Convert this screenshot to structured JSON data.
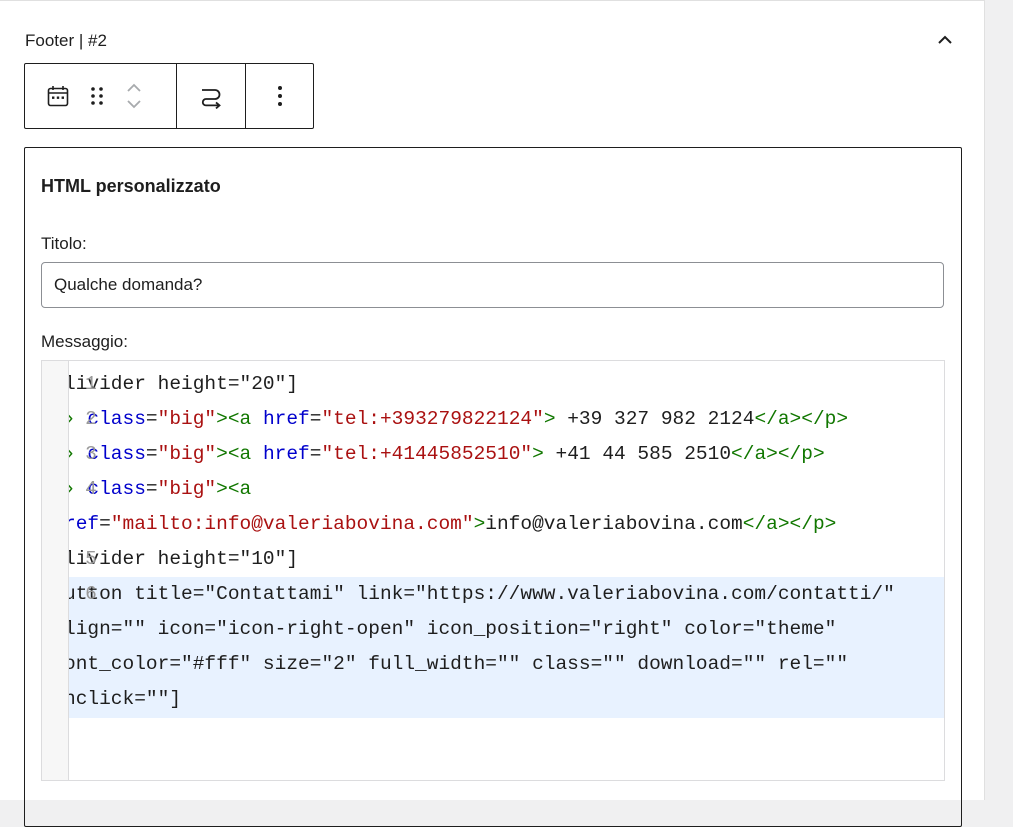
{
  "block": {
    "title": "Footer | #2",
    "toolbar": {
      "icons": [
        "calendar-icon",
        "drag-handle-icon",
        "move-up-icon",
        "move-down-icon",
        "loop-icon",
        "more-options-icon"
      ]
    }
  },
  "widget": {
    "title": "HTML personalizzato",
    "titolo_label": "Titolo:",
    "titolo_value": "Qualche domanda?",
    "messaggio_label": "Messaggio:",
    "code": [
      {
        "n": "1",
        "segments": [
          {
            "t": "livider height=\"20\"]",
            "c": ""
          }
        ]
      },
      {
        "n": "2",
        "segments": [
          {
            "t": "› ",
            "c": "tag"
          },
          {
            "t": "class",
            "c": "attr"
          },
          {
            "t": "=",
            "c": ""
          },
          {
            "t": "\"big\"",
            "c": "str"
          },
          {
            "t": "><a ",
            "c": "tag"
          },
          {
            "t": "href",
            "c": "attr"
          },
          {
            "t": "=",
            "c": ""
          },
          {
            "t": "\"tel:+393279822124\"",
            "c": "str"
          },
          {
            "t": ">",
            "c": "tag"
          },
          {
            "t": " +39 327 982 2124",
            "c": ""
          },
          {
            "t": "</a></p>",
            "c": "tag"
          }
        ]
      },
      {
        "n": "3",
        "segments": [
          {
            "t": "› ",
            "c": "tag"
          },
          {
            "t": "class",
            "c": "attr"
          },
          {
            "t": "=",
            "c": ""
          },
          {
            "t": "\"big\"",
            "c": "str"
          },
          {
            "t": "><a ",
            "c": "tag"
          },
          {
            "t": "href",
            "c": "attr"
          },
          {
            "t": "=",
            "c": ""
          },
          {
            "t": "\"tel:+41445852510\"",
            "c": "str"
          },
          {
            "t": ">",
            "c": "tag"
          },
          {
            "t": " +41 44 585 2510",
            "c": ""
          },
          {
            "t": "</a></p>",
            "c": "tag"
          }
        ]
      },
      {
        "n": "4",
        "segments": [
          {
            "t": "› ",
            "c": "tag"
          },
          {
            "t": "class",
            "c": "attr"
          },
          {
            "t": "=",
            "c": ""
          },
          {
            "t": "\"big\"",
            "c": "str"
          },
          {
            "t": "><a",
            "c": "tag"
          }
        ]
      },
      {
        "n": "",
        "segments": [
          {
            "t": "ref",
            "c": "attr"
          },
          {
            "t": "=",
            "c": ""
          },
          {
            "t": "\"mailto:info@valeriabovina.com\"",
            "c": "str"
          },
          {
            "t": ">",
            "c": "tag"
          },
          {
            "t": "info@valeriabovina.com",
            "c": ""
          },
          {
            "t": "</a></p>",
            "c": "tag"
          }
        ]
      },
      {
        "n": "5",
        "segments": [
          {
            "t": "livider height=\"10\"]",
            "c": ""
          }
        ]
      },
      {
        "n": "6",
        "segments": [
          {
            "t": "utton title=\"Contattami\" link=\"https://www.valeriabovina.com/contatti/\"",
            "c": ""
          }
        ]
      },
      {
        "n": "",
        "segments": [
          {
            "t": "lign=\"\" icon=\"icon-right-open\" icon_position=\"right\" color=\"theme\"",
            "c": ""
          }
        ]
      },
      {
        "n": "",
        "segments": [
          {
            "t": "ont_color=\"#fff\" size=\"2\" full_width=\"\" class=\"\" download=\"\" rel=\"\"",
            "c": ""
          }
        ]
      },
      {
        "n": "",
        "segments": [
          {
            "t": "nclick=\"\"]",
            "c": ""
          }
        ]
      }
    ]
  },
  "colors": {
    "tag": "#117700",
    "attribute": "#0000cc",
    "string": "#aa1111",
    "active_line_highlight": "#e8f2ff"
  }
}
